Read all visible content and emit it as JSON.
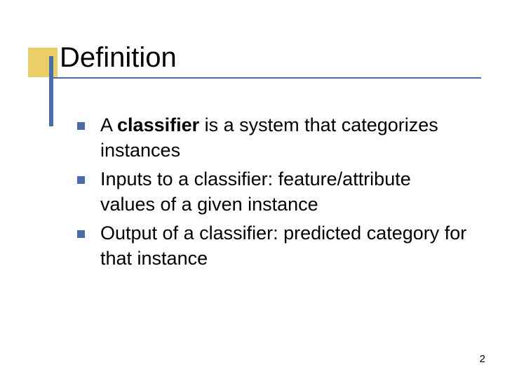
{
  "slide": {
    "title": "Definition",
    "page_number": "2"
  },
  "bullets": [
    {
      "prefix": "A ",
      "bold": "classifier",
      "rest": " is a system that categorizes instances"
    },
    {
      "prefix": "",
      "bold": "",
      "rest": "Inputs to a classifier:  feature/attribute values of a given instance"
    },
    {
      "prefix": "",
      "bold": "",
      "rest": "Output of a classifier: predicted category for that instance"
    }
  ]
}
